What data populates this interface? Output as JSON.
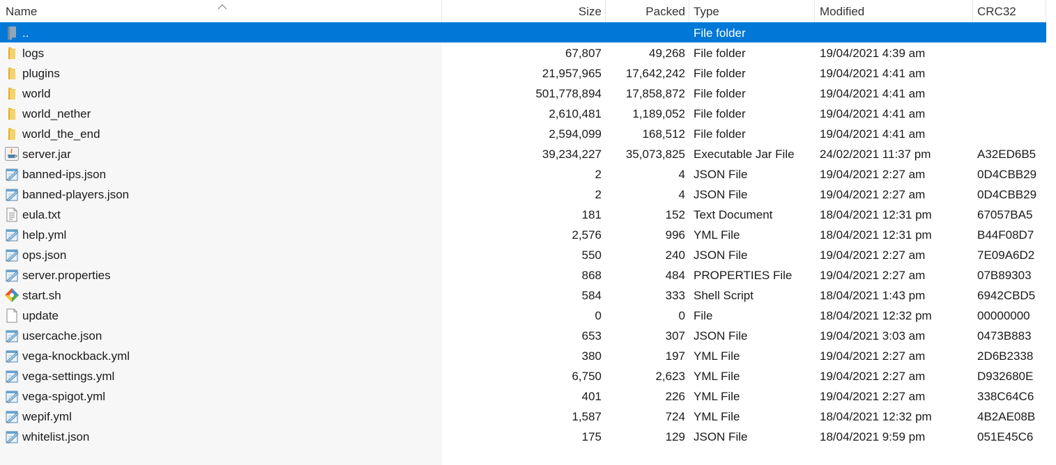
{
  "columns": {
    "name": "Name",
    "size": "Size",
    "packed": "Packed",
    "type": "Type",
    "modified": "Modified",
    "crc": "CRC32"
  },
  "colors": {
    "selection": "#0078d7",
    "folder": "#f3c74c",
    "name_column_bg": "#f7f7f7"
  },
  "rows": [
    {
      "icon": "parent-folder-icon",
      "name": "..",
      "size": "",
      "packed": "",
      "type": "File folder",
      "modified": "",
      "crc": "",
      "selected": true
    },
    {
      "icon": "folder-icon",
      "name": "logs",
      "size": "67,807",
      "packed": "49,268",
      "type": "File folder",
      "modified": "19/04/2021 4:39 am",
      "crc": ""
    },
    {
      "icon": "folder-icon",
      "name": "plugins",
      "size": "21,957,965",
      "packed": "17,642,242",
      "type": "File folder",
      "modified": "19/04/2021 4:41 am",
      "crc": ""
    },
    {
      "icon": "folder-icon",
      "name": "world",
      "size": "501,778,894",
      "packed": "17,858,872",
      "type": "File folder",
      "modified": "19/04/2021 4:41 am",
      "crc": ""
    },
    {
      "icon": "folder-icon",
      "name": "world_nether",
      "size": "2,610,481",
      "packed": "1,189,052",
      "type": "File folder",
      "modified": "19/04/2021 4:41 am",
      "crc": ""
    },
    {
      "icon": "folder-icon",
      "name": "world_the_end",
      "size": "2,594,099",
      "packed": "168,512",
      "type": "File folder",
      "modified": "19/04/2021 4:41 am",
      "crc": ""
    },
    {
      "icon": "java-jar-icon",
      "name": "server.jar",
      "size": "39,234,227",
      "packed": "35,073,825",
      "type": "Executable Jar File",
      "modified": "24/02/2021 11:37 pm",
      "crc": "A32ED6B5"
    },
    {
      "icon": "notepad-file-icon",
      "name": "banned-ips.json",
      "size": "2",
      "packed": "4",
      "type": "JSON File",
      "modified": "19/04/2021 2:27 am",
      "crc": "0D4CBB29"
    },
    {
      "icon": "notepad-file-icon",
      "name": "banned-players.json",
      "size": "2",
      "packed": "4",
      "type": "JSON File",
      "modified": "19/04/2021 2:27 am",
      "crc": "0D4CBB29"
    },
    {
      "icon": "text-document-icon",
      "name": "eula.txt",
      "size": "181",
      "packed": "152",
      "type": "Text Document",
      "modified": "18/04/2021 12:31 pm",
      "crc": "67057BA5"
    },
    {
      "icon": "notepad-file-icon",
      "name": "help.yml",
      "size": "2,576",
      "packed": "996",
      "type": "YML File",
      "modified": "18/04/2021 12:31 pm",
      "crc": "B44F08D7"
    },
    {
      "icon": "notepad-file-icon",
      "name": "ops.json",
      "size": "550",
      "packed": "240",
      "type": "JSON File",
      "modified": "19/04/2021 2:27 am",
      "crc": "7E09A6D2"
    },
    {
      "icon": "notepad-file-icon",
      "name": "server.properties",
      "size": "868",
      "packed": "484",
      "type": "PROPERTIES File",
      "modified": "19/04/2021 2:27 am",
      "crc": "07B89303"
    },
    {
      "icon": "git-shell-icon",
      "name": "start.sh",
      "size": "584",
      "packed": "333",
      "type": "Shell Script",
      "modified": "18/04/2021 1:43 pm",
      "crc": "6942CBD5"
    },
    {
      "icon": "blank-file-icon",
      "name": "update",
      "size": "0",
      "packed": "0",
      "type": "File",
      "modified": "18/04/2021 12:32 pm",
      "crc": "00000000"
    },
    {
      "icon": "notepad-file-icon",
      "name": "usercache.json",
      "size": "653",
      "packed": "307",
      "type": "JSON File",
      "modified": "19/04/2021 3:03 am",
      "crc": "0473B883"
    },
    {
      "icon": "notepad-file-icon",
      "name": "vega-knockback.yml",
      "size": "380",
      "packed": "197",
      "type": "YML File",
      "modified": "19/04/2021 2:27 am",
      "crc": "2D6B2338"
    },
    {
      "icon": "notepad-file-icon",
      "name": "vega-settings.yml",
      "size": "6,750",
      "packed": "2,623",
      "type": "YML File",
      "modified": "19/04/2021 2:27 am",
      "crc": "D932680E"
    },
    {
      "icon": "notepad-file-icon",
      "name": "vega-spigot.yml",
      "size": "401",
      "packed": "226",
      "type": "YML File",
      "modified": "19/04/2021 2:27 am",
      "crc": "338C64C6"
    },
    {
      "icon": "notepad-file-icon",
      "name": "wepif.yml",
      "size": "1,587",
      "packed": "724",
      "type": "YML File",
      "modified": "18/04/2021 12:32 pm",
      "crc": "4B2AE08B"
    },
    {
      "icon": "notepad-file-icon",
      "name": "whitelist.json",
      "size": "175",
      "packed": "129",
      "type": "JSON File",
      "modified": "18/04/2021 9:59 pm",
      "crc": "051E45C6"
    }
  ]
}
